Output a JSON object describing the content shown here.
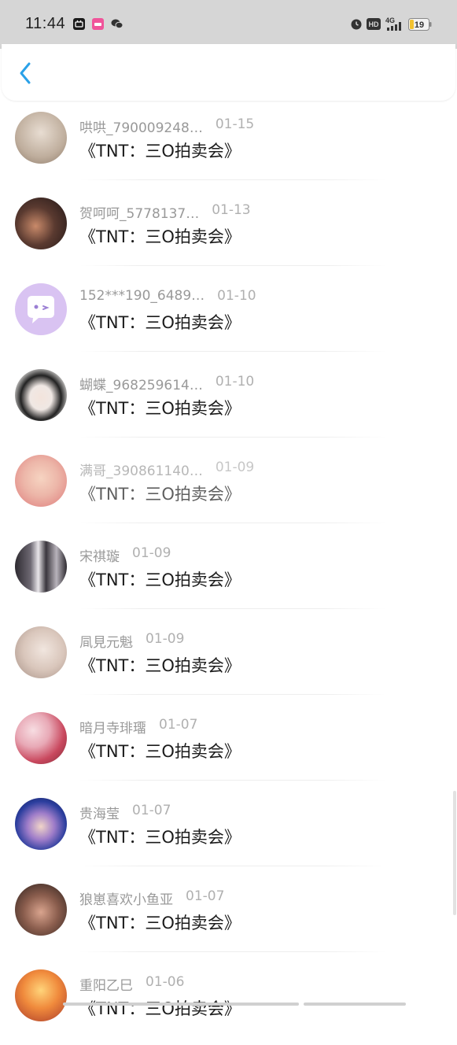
{
  "status_bar": {
    "time": "11:44",
    "app_icons": [
      "bilibili-icon",
      "app-icon",
      "wechat-icon"
    ],
    "network": "4G",
    "battery": "19"
  },
  "header": {
    "back_icon": "chevron-left-icon",
    "accent_color": "#2aa1e8"
  },
  "items": [
    {
      "name": "哄哄_790009248…",
      "date": "01-15",
      "message": "《TNT：三O拍卖会》",
      "avatar_color": "#bfae9d"
    },
    {
      "name": "贺呵呵_5778137…",
      "date": "01-13",
      "message": "《TNT：三O拍卖会》",
      "avatar_color": "#3b2a26"
    },
    {
      "name": "152***190_6489…",
      "date": "01-10",
      "message": "《TNT：三O拍卖会》",
      "avatar_color": "#d9c3f2"
    },
    {
      "name": "蝴蝶_968259614…",
      "date": "01-10",
      "message": "《TNT：三O拍卖会》",
      "avatar_color": "#e6e0dc"
    },
    {
      "name": "满哥_390861140…",
      "date": "01-09",
      "message": "《TNT：三O拍卖会》",
      "avatar_color": "#e08f86"
    },
    {
      "name": "宋祺璇",
      "date": "01-09",
      "message": "《TNT：三O拍卖会》",
      "avatar_color": "#4f4a52"
    },
    {
      "name": "凬見元魁",
      "date": "01-09",
      "message": "《TNT：三O拍卖会》",
      "avatar_color": "#d9c6bb"
    },
    {
      "name": "暗月寺琲璢",
      "date": "01-07",
      "message": "《TNT：三O拍卖会》",
      "avatar_color": "#e3bcc4"
    },
    {
      "name": "贵海莹",
      "date": "01-07",
      "message": "《TNT：三O拍卖会》",
      "avatar_color": "#3d4f9e"
    },
    {
      "name": "狼崽喜欢小鱼亚",
      "date": "01-07",
      "message": "《TNT：三O拍卖会》",
      "avatar_color": "#6b4c43"
    },
    {
      "name": "重阳乙巳",
      "date": "01-06",
      "message": "《TNT：三O拍卖会》",
      "avatar_color": "#e07a3c"
    }
  ]
}
